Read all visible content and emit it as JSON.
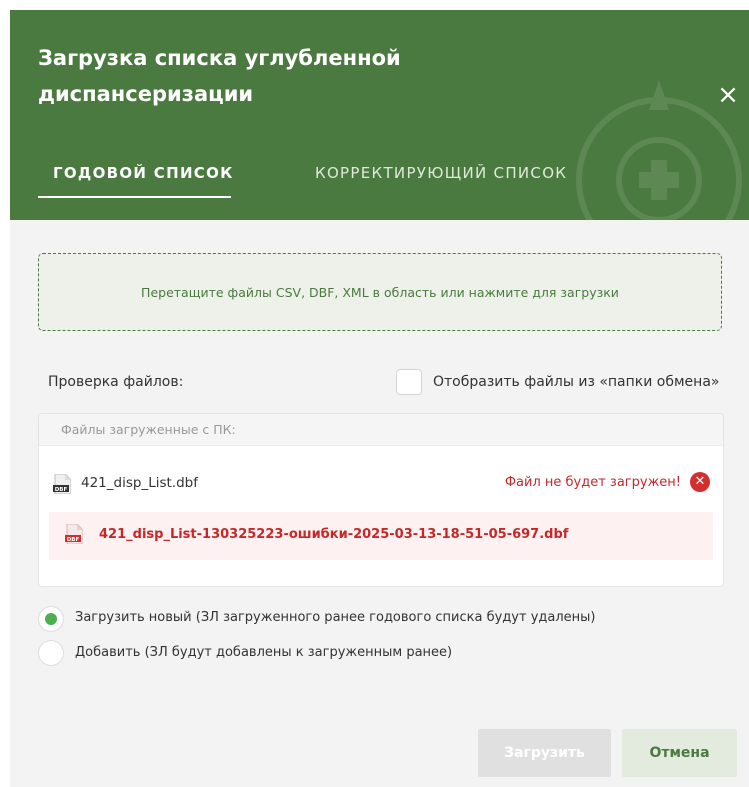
{
  "dialog": {
    "title": "Загрузка списка углубленной диспансеризации",
    "close_label": "×"
  },
  "tabs": [
    {
      "label": "ГОДОВОЙ СПИСОК",
      "active": true
    },
    {
      "label": "КОРРЕКТИРУЮЩИЙ СПИСОК",
      "active": false
    }
  ],
  "dropzone": {
    "text": "Перетащите файлы CSV, DBF, XML в область или нажмите для загрузки"
  },
  "file_check": {
    "label": "Проверка файлов:",
    "exchange_checkbox_label": "Отобразить файлы из «папки обмена»",
    "exchange_checked": false
  },
  "files_panel": {
    "header": "Файлы загруженные с ПК:",
    "files": [
      {
        "name": "421_disp_List.dbf",
        "icon": "dbf-file-icon",
        "status": "Файл не будет загружен!",
        "error_file": "421_disp_List-130325223-ошибки-2025-03-13-18-51-05-697.dbf"
      }
    ]
  },
  "upload_mode": {
    "options": [
      {
        "label": "Загрузить новый (ЗЛ загруженного ранее годового списка будут удалены)",
        "selected": true
      },
      {
        "label": "Добавить (ЗЛ будут добавлены к загруженным ранее)",
        "selected": false
      }
    ]
  },
  "buttons": {
    "upload_label": "Загрузить",
    "cancel_label": "Отмена"
  },
  "colors": {
    "header_bg": "#4a7a3f",
    "accent_green": "#4caf50",
    "error_red": "#c62828"
  }
}
